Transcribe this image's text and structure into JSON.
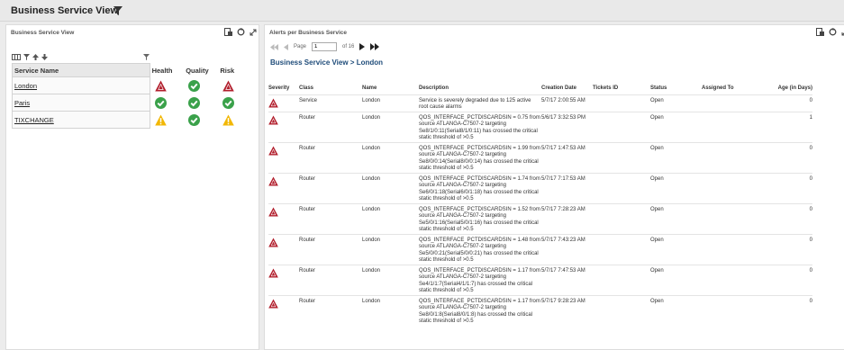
{
  "page_title": "Business Service View",
  "left_panel": {
    "title": "Business Service View",
    "columns": [
      "Service Name",
      "Health",
      "Quality",
      "Risk"
    ],
    "rows": [
      {
        "name": "London",
        "health": "critical",
        "quality": "ok",
        "risk": "critical"
      },
      {
        "name": "Paris",
        "health": "ok",
        "quality": "ok",
        "risk": "ok"
      },
      {
        "name": "TIXCHANGE",
        "health": "warning",
        "quality": "ok",
        "risk": "warning"
      }
    ]
  },
  "right_panel": {
    "title": "Alerts per Business Service",
    "pager": {
      "page_label": "Page",
      "page_value": "1",
      "of_label": "of 16"
    },
    "breadcrumb": "Business Service View  >  London",
    "columns": [
      "Severity",
      "Class",
      "Name",
      "Description",
      "Creation Date",
      "Tickets ID",
      "Status",
      "Assigned To",
      "Age (in Days)"
    ],
    "rows": [
      {
        "class": "Service",
        "name": "London",
        "description": "Service is severely degraded due to 125 active root cause alarms",
        "date": "5/7/17 2:00:55 AM",
        "tickets": "",
        "status": "Open",
        "assigned": "",
        "age": "0"
      },
      {
        "class": "Router",
        "name": "London",
        "description": "QOS_INTERFACE_PCTDISCARDSIN = 0.75 from source ATLANGA-C7507-2 targeting Se8/1/0:11(Serial8/1/0:11) has crossed the critical static threshold of >0.5",
        "date": "5/6/17 3:32:53 PM",
        "tickets": "",
        "status": "Open",
        "assigned": "",
        "age": "1"
      },
      {
        "class": "Router",
        "name": "London",
        "description": "QOS_INTERFACE_PCTDISCARDSIN = 1.99 from source ATLANGA-C7507-2 targeting Se8/0/0:14(Serial8/0/0:14) has crossed the critical static threshold of >0.5",
        "date": "5/7/17 1:47:53 AM",
        "tickets": "",
        "status": "Open",
        "assigned": "",
        "age": "0"
      },
      {
        "class": "Router",
        "name": "London",
        "description": "QOS_INTERFACE_PCTDISCARDSIN = 1.74 from source ATLANGA-C7507-2 targeting Se6/0/1:18(Serial6/0/1:18) has crossed the critical static threshold of >0.5",
        "date": "5/7/17 7:17:53 AM",
        "tickets": "",
        "status": "Open",
        "assigned": "",
        "age": "0"
      },
      {
        "class": "Router",
        "name": "London",
        "description": "QOS_INTERFACE_PCTDISCARDSIN = 1.52 from source ATLANGA-C7507-2 targeting Se5/0/1:16(Serial5/0/1:16) has crossed the critical static threshold of >0.5",
        "date": "5/7/17 7:28:23 AM",
        "tickets": "",
        "status": "Open",
        "assigned": "",
        "age": "0"
      },
      {
        "class": "Router",
        "name": "London",
        "description": "QOS_INTERFACE_PCTDISCARDSIN = 1.48 from source ATLANGA-C7507-2 targeting Se5/0/0:21(Serial5/0/0:21) has crossed the critical static threshold of >0.5",
        "date": "5/7/17 7:43:23 AM",
        "tickets": "",
        "status": "Open",
        "assigned": "",
        "age": "0"
      },
      {
        "class": "Router",
        "name": "London",
        "description": "QOS_INTERFACE_PCTDISCARDSIN = 1.17 from source ATLANGA-C7507-2 targeting Se4/1/1:7(Serial4/1/1:7) has crossed the critical static threshold of >0.5",
        "date": "5/7/17 7:47:53 AM",
        "tickets": "",
        "status": "Open",
        "assigned": "",
        "age": "0"
      },
      {
        "class": "Router",
        "name": "London",
        "description": "QOS_INTERFACE_PCTDISCARDSIN = 1.17 from source ATLANGA-C7507-2 targeting Se8/0/1:8(Serial8/0/1:8) has crossed the critical static threshold of >0.5",
        "date": "5/7/17 9:28:23 AM",
        "tickets": "",
        "status": "Open",
        "assigned": "",
        "age": "0"
      }
    ]
  },
  "colors": {
    "critical": "#b21f2d",
    "ok": "#3aa14a",
    "warning": "#f2b705",
    "link": "#1e4b79"
  }
}
